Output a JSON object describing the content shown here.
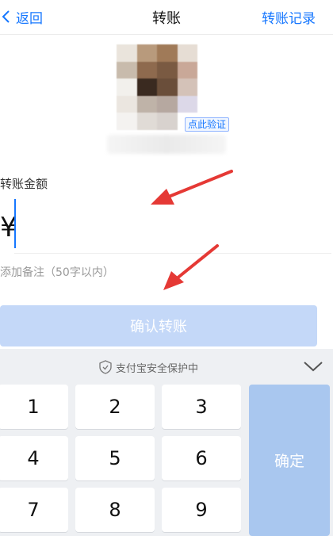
{
  "header": {
    "back_label": "返回",
    "title": "转账",
    "records_label": "转账记录"
  },
  "recipient": {
    "verify_label": "点此验证"
  },
  "amount": {
    "label": "转账金额",
    "currency_symbol": "¥",
    "value": ""
  },
  "remark": {
    "placeholder": "添加备注（50字以内）"
  },
  "confirm": {
    "label": "确认转账"
  },
  "keyboard": {
    "security_text": "支付宝安全保护中",
    "keys": [
      "1",
      "2",
      "3",
      "4",
      "5",
      "6",
      "7",
      "8",
      "9"
    ],
    "ok_label": "确定"
  },
  "colors": {
    "accent": "#1677ff",
    "arrow": "#e53935",
    "confirm_disabled": "#c4d8f8",
    "ok_key": "#a9c7ef",
    "keyboard_bg": "#eef0f3"
  }
}
